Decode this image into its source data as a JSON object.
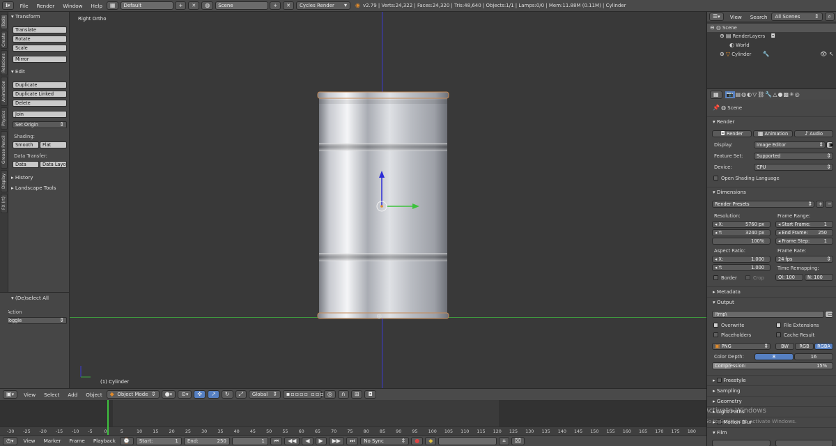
{
  "topbar": {
    "menus": [
      "File",
      "Render",
      "Window",
      "Help"
    ],
    "layout_value": "Default",
    "scene_value": "Scene",
    "engine_value": "Cycles Render",
    "stats": "v2.79 | Verts:24,322 | Faces:24,320 | Tris:48,640 | Objects:1/1 | Lamps:0/0 | Mem:11.88M (0.11M) | Cylinder"
  },
  "side_tabs": [
    "Tools",
    "Create",
    "Relations",
    "Animation",
    "Physics",
    "Grease Pencil",
    "Display",
    "FX (rt)"
  ],
  "tool_shelf": {
    "transform_header": "Transform",
    "transform_buttons": [
      "Translate",
      "Rotate",
      "Scale",
      "Mirror"
    ],
    "edit_header": "Edit",
    "edit_buttons": [
      "Duplicate",
      "Duplicate Linked",
      "Delete",
      "Join"
    ],
    "set_origin": "Set Origin",
    "shading_label": "Shading:",
    "shading_buttons": [
      "Smooth",
      "Flat"
    ],
    "data_transfer_label": "Data Transfer:",
    "data_buttons": [
      "Data",
      "Data Layo"
    ],
    "history_header": "History",
    "landscape_header": "Landscape Tools",
    "operator_header": "(De)select All",
    "action_label": "Action",
    "action_value": "Toggle"
  },
  "viewport": {
    "view_label": "Right Ortho",
    "object_label": "(1) Cylinder"
  },
  "viewport_header": {
    "menus": [
      "View",
      "Select",
      "Add",
      "Object"
    ],
    "mode": "Object Mode",
    "orientation": "Global"
  },
  "timeline": {
    "ticks": [
      "-30",
      "-25",
      "-20",
      "-15",
      "-10",
      "-5",
      "0",
      "5",
      "10",
      "15",
      "20",
      "25",
      "30",
      "35",
      "40",
      "45",
      "50",
      "55",
      "60",
      "65",
      "70",
      "75",
      "80",
      "85",
      "90",
      "95",
      "100",
      "105",
      "110",
      "115",
      "120",
      "125",
      "130",
      "135",
      "140",
      "145",
      "150",
      "155",
      "160",
      "165",
      "170",
      "175",
      "180"
    ],
    "current_frame_fraction": 0.5
  },
  "timeline_header": {
    "menus": [
      "View",
      "Marker",
      "Frame",
      "Playback"
    ],
    "start_label": "Start:",
    "start_value": "1",
    "end_label": "End:",
    "end_value": "250",
    "current_value": "1",
    "sync": "No Sync"
  },
  "outliner": {
    "menus": [
      "View",
      "Search"
    ],
    "filter": "All Scenes",
    "items": [
      "Scene",
      "RenderLayers",
      "World",
      "Cylinder"
    ]
  },
  "properties": {
    "context": "Scene",
    "render_header": "Render",
    "render_buttons": [
      "Render",
      "Animation",
      "Audio"
    ],
    "display_label": "Display:",
    "display_value": "Image Editor",
    "feature_label": "Feature Set:",
    "feature_value": "Supported",
    "device_label": "Device:",
    "device_value": "CPU",
    "osl_label": "Open Shading Language",
    "dimensions_header": "Dimensions",
    "presets": "Render Presets",
    "resolution_label": "Resolution:",
    "res_x": "5760 px",
    "res_y": "3240 px",
    "res_pct": "100%",
    "frame_range_label": "Frame Range:",
    "start_frame": "1",
    "end_frame": "250",
    "frame_step": "1",
    "aspect_label": "Aspect Ratio:",
    "aspect_x": "1.000",
    "aspect_y": "1.000",
    "frame_rate_label": "Frame Rate:",
    "fps": "24 fps",
    "remap_label": "Time Remapping:",
    "remap_old": "Ol: 100",
    "remap_new": "N: 100",
    "border_label": "Border",
    "crop_label": "Crop",
    "metadata_header": "Metadata",
    "output_header": "Output",
    "output_path": "/tmp\\",
    "overwrite_label": "Overwrite",
    "file_ext_label": "File Extensions",
    "placeholders_label": "Placeholders",
    "cache_label": "Cache Result",
    "format": "PNG",
    "color_modes": [
      "BW",
      "RGB",
      "RGBA"
    ],
    "color_depth_label": "Color Depth:",
    "depth_8": "8",
    "depth_16": "16",
    "compression_label": "Compression:",
    "compression_value": "15%",
    "compression_fraction": 0.15,
    "bottom_headers": [
      "Freestyle",
      "Sampling",
      "Geometry",
      "Light Paths",
      "Motion Blur",
      "Film"
    ],
    "watermark_line1": "Activate Windows",
    "watermark_line2": "Go to Settings to activate Windows."
  },
  "colors": {
    "accent_blue": "#5680c2",
    "panel": "#474747",
    "viewport": "#393939",
    "x_axis": "#6aa84f",
    "z_axis": "#3b3bd9",
    "timeline_frame": "#3fc23f"
  }
}
